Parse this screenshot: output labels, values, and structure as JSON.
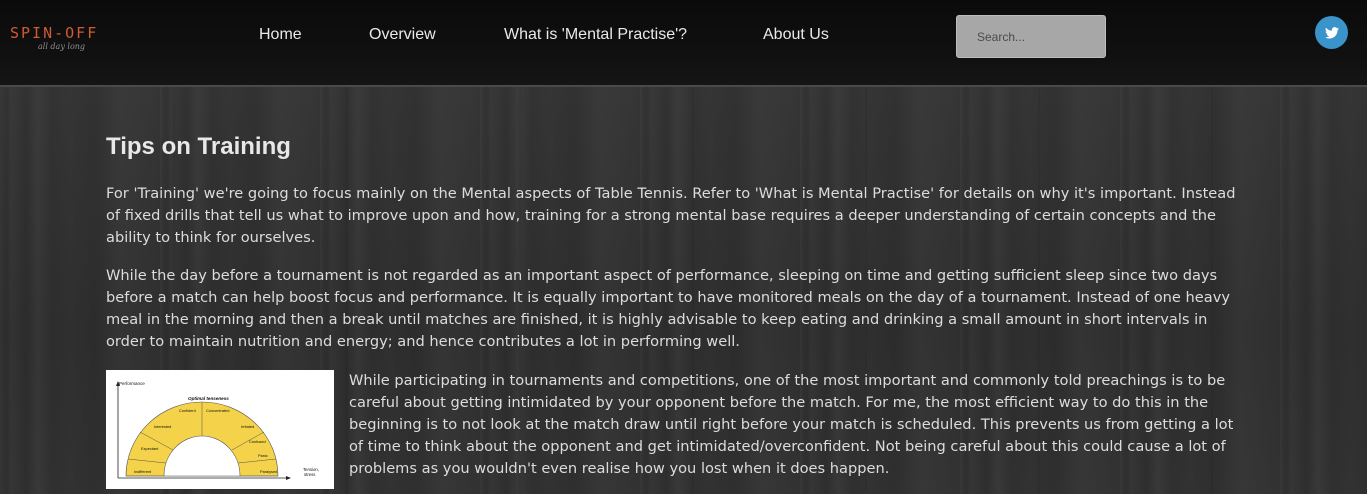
{
  "nav": {
    "logo_main": "SPIN-OFF",
    "logo_sub": "all day long",
    "links": [
      "Home",
      "Overview",
      "What is 'Mental Practise'?",
      "About Us"
    ],
    "search_placeholder": "Search...",
    "twitter_icon": "twitter-icon",
    "twitter_color": "#3b93cc"
  },
  "main": {
    "title": "Tips on Training",
    "paragraphs": [
      "For 'Training' we're going to focus mainly on the Mental aspects of Table Tennis. Refer to 'What is Mental Practise' for details on why it's important. Instead of fixed drills that tell us what to improve upon and how, training for a strong mental base requires a deeper understanding of certain concepts and the ability to think for ourselves.",
      "While the day before a tournament is not regarded as an important aspect of performance, sleeping on time and getting sufficient sleep since two days before a match can help boost focus and performance. It is equally important to have monitored meals on the day of a tournament. Instead of one heavy meal in the morning and then a break until matches are finished, it is highly advisable to keep eating and drinking a small amount in short intervals in order to maintain nutrition and energy; and hence contributes a lot in performing well.",
      "While participating in tournaments and competitions, one of the most important and commonly told preachings is to be careful about getting intimidated by your opponent before the match. For me, the most efficient way to do this in the beginning is to not look at the match draw until right before your match is scheduled. This prevents us from getting a lot of time to think about the opponent and get intimidated/overconfident. Not being careful about this could cause a lot of problems as you wouldn't even realise how you lost when it does happen."
    ],
    "diagram": {
      "y_label": "Performance",
      "x_label_1": "Tension,",
      "x_label_2": "stress",
      "peak_label": "Optimal tenseness",
      "segments": [
        "Indifferent",
        "Expectant",
        "Interested",
        "Confident",
        "Concentrated",
        "Irritated",
        "Confused",
        "Panic",
        "Paralysed"
      ],
      "fill_color": "#f4d24a"
    }
  }
}
